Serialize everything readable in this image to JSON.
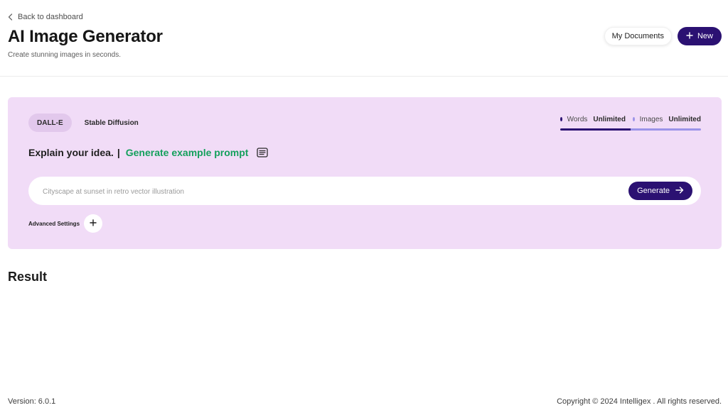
{
  "header": {
    "back_label": "Back to dashboard",
    "title": "AI Image Generator",
    "subtitle": "Create stunning images in seconds.",
    "my_documents_label": "My Documents",
    "new_label": "New"
  },
  "generator": {
    "tabs": [
      {
        "label": "DALL-E",
        "active": true
      },
      {
        "label": "Stable Diffusion",
        "active": false
      }
    ],
    "usage": {
      "words_label": "Words",
      "words_value": "Unlimited",
      "images_label": "Images",
      "images_value": "Unlimited",
      "words_color": "#2b1172",
      "images_color": "#9b93e8"
    },
    "heading": "Explain your idea.",
    "separator": "|",
    "example_link": "Generate example prompt",
    "prompt_placeholder": "Cityscape at sunset in retro vector illustration",
    "generate_label": "Generate",
    "advanced_label": "Advanced Settings"
  },
  "result": {
    "title": "Result"
  },
  "footer": {
    "version": "Version: 6.0.1",
    "copyright": "Copyright © 2024 Intelligex . All rights reserved."
  },
  "colors": {
    "accent": "#2b1172",
    "panel_bg": "#f1dcf7",
    "link_green": "#14a05c"
  },
  "icons": {
    "back": "chevron-left-icon",
    "new": "plus-icon",
    "example": "document-lines-icon",
    "generate": "arrow-right-icon",
    "advanced": "plus-icon"
  }
}
